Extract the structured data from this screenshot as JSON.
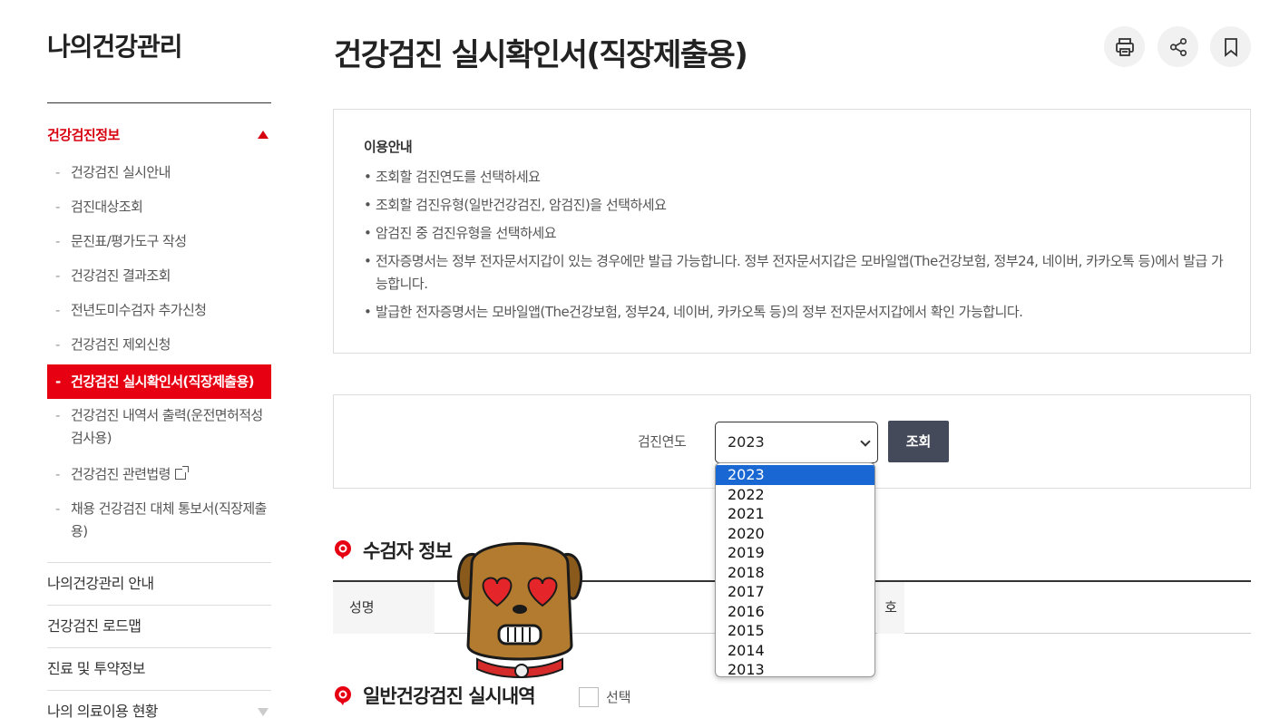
{
  "sidebar": {
    "title": "나의건강관리",
    "group_label": "건강검진정보",
    "sub_items": [
      "건강검진 실시안내",
      "검진대상조회",
      "문진표/평가도구 작성",
      "건강검진 결과조회",
      "전년도미수검자 추가신청",
      "건강검진 제외신청",
      "건강검진 실시확인서(직장제출용)",
      "건강검진 내역서 출력(운전면허적성검사용)",
      "건강검진 관련법령",
      "채용 건강검진 대체 통보서(직장제출용)"
    ],
    "active_index": 6,
    "menu_items": [
      "나의건강관리 안내",
      "건강검진 로드맵",
      "진료 및 투약정보",
      "나의 의료이용 현황"
    ]
  },
  "header": {
    "title": "건강검진 실시확인서(직장제출용)",
    "icons": [
      "print-icon",
      "share-icon",
      "bookmark-icon"
    ]
  },
  "info": {
    "title": "이용안내",
    "items": [
      "조회할 검진연도를 선택하세요",
      "조회할 검진유형(일반건강검진, 암검진)을 선택하세요",
      "암검진 중 검진유형을 선택하세요",
      "전자증명서는 정부 전자문서지갑이 있는 경우에만 발급 가능합니다. 정부 전자문서지갑은 모바일앱(The건강보험, 정부24, 네이버, 카카오톡 등)에서 발급 가능합니다.",
      "발급한 전자증명서는 모바일앱(The건강보험, 정부24, 네이버, 카카오톡 등)의 정부 전자문서지갑에서 확인 가능합니다."
    ]
  },
  "search": {
    "label": "검진연도",
    "selected": "2023",
    "options": [
      "2023",
      "2022",
      "2021",
      "2020",
      "2019",
      "2018",
      "2017",
      "2016",
      "2015",
      "2014",
      "2013"
    ],
    "button": "조회"
  },
  "section1": {
    "title": "수검자 정보",
    "name_header": "성명",
    "partial_header": "호"
  },
  "section2": {
    "title": "일반건강검진 실시내역",
    "checkbox_label": "선택"
  },
  "colors": {
    "accent_red": "#d7000f",
    "active_bg": "#e60012",
    "button_dark": "#444a5a",
    "select_highlight": "#1967d2"
  }
}
